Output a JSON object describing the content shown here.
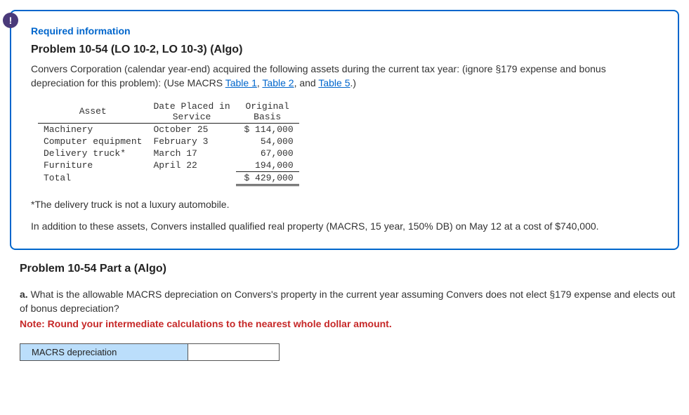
{
  "alert_icon": "!",
  "required_info": "Required information",
  "problem_title": "Problem 10-54 (LO 10-2, LO 10-3) (Algo)",
  "desc_part1": "Convers Corporation (calendar year-end) acquired the following assets during the current tax year: (ignore §179 expense and bonus depreciation for this problem): (Use MACRS ",
  "link1": "Table 1",
  "desc_comma": ", ",
  "link2": "Table 2",
  "desc_and": ", and ",
  "link3": "Table 5",
  "desc_end": ".)",
  "table": {
    "headers": {
      "asset": "Asset",
      "date": "Date Placed in\nService",
      "basis": "Original\nBasis"
    },
    "rows": [
      {
        "asset": "Machinery",
        "date": "October 25",
        "basis": "$ 114,000"
      },
      {
        "asset": "Computer equipment",
        "date": "February 3",
        "basis": "54,000"
      },
      {
        "asset": "Delivery truck*",
        "date": "March 17",
        "basis": "67,000"
      },
      {
        "asset": "Furniture",
        "date": "April 22",
        "basis": "194,000"
      }
    ],
    "total_label": "Total",
    "total_value": "$ 429,000"
  },
  "footnote": "*The delivery truck is not a luxury automobile.",
  "additional": "In addition to these assets, Convers installed qualified real property (MACRS, 15 year, 150% DB) on May 12 at a cost of $740,000.",
  "part_title": "Problem 10-54 Part a (Algo)",
  "question_prefix": "a.",
  "question_text": " What is the allowable MACRS depreciation on Convers's property in the current year assuming Convers does not elect §179 expense and elects out of bonus depreciation?",
  "note": "Note: Round your intermediate calculations to the nearest whole dollar amount.",
  "answer_label": "MACRS depreciation",
  "answer_value": ""
}
